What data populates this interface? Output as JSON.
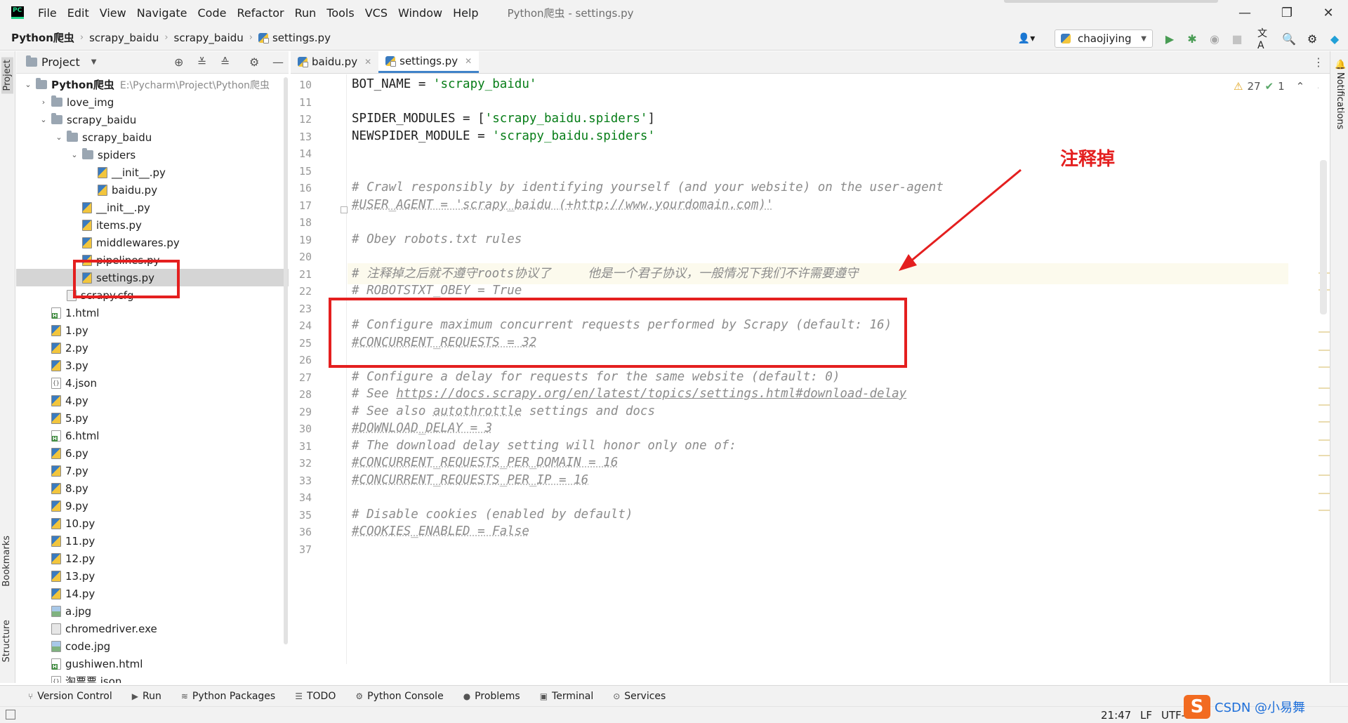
{
  "window": {
    "title": "Python爬虫 - settings.py",
    "menu": [
      "File",
      "Edit",
      "View",
      "Navigate",
      "Code",
      "Refactor",
      "Run",
      "Tools",
      "VCS",
      "Window",
      "Help"
    ],
    "controls": {
      "minimize": "—",
      "maximize": "❐",
      "close": "✕"
    }
  },
  "breadcrumb": [
    "Python爬虫",
    "scrapy_baidu",
    "scrapy_baidu",
    "settings.py"
  ],
  "toolbar": {
    "run_config": "chaojiying",
    "icons": [
      "user-icon",
      "run-icon",
      "debug-icon",
      "coverage-icon",
      "stop-icon",
      "translate-icon",
      "search-icon",
      "settings-icon",
      "jetbrains-icon"
    ]
  },
  "project_panel": {
    "title": "Project",
    "tree": [
      {
        "label": "Python爬虫",
        "path": "E:\\Pycharm\\Project\\Python爬虫",
        "type": "folder",
        "depth": 0,
        "expanded": true
      },
      {
        "label": "love_img",
        "type": "folder",
        "depth": 1,
        "expanded": false
      },
      {
        "label": "scrapy_baidu",
        "type": "folder",
        "depth": 1,
        "expanded": true
      },
      {
        "label": "scrapy_baidu",
        "type": "folder",
        "depth": 2,
        "expanded": true
      },
      {
        "label": "spiders",
        "type": "folder",
        "depth": 3,
        "expanded": true
      },
      {
        "label": "__init__.py",
        "type": "py",
        "depth": 4
      },
      {
        "label": "baidu.py",
        "type": "py",
        "depth": 4
      },
      {
        "label": "__init__.py",
        "type": "py",
        "depth": 3
      },
      {
        "label": "items.py",
        "type": "py",
        "depth": 3
      },
      {
        "label": "middlewares.py",
        "type": "py",
        "depth": 3
      },
      {
        "label": "pipelines.py",
        "type": "py",
        "depth": 3
      },
      {
        "label": "settings.py",
        "type": "py",
        "depth": 3,
        "selected": true
      },
      {
        "label": "scrapy.cfg",
        "type": "cfg",
        "depth": 2
      },
      {
        "label": "1.html",
        "type": "html",
        "depth": 1
      },
      {
        "label": "1.py",
        "type": "py",
        "depth": 1
      },
      {
        "label": "2.py",
        "type": "py",
        "depth": 1
      },
      {
        "label": "3.py",
        "type": "py",
        "depth": 1
      },
      {
        "label": "4.json",
        "type": "json",
        "depth": 1
      },
      {
        "label": "4.py",
        "type": "py",
        "depth": 1
      },
      {
        "label": "5.py",
        "type": "py",
        "depth": 1
      },
      {
        "label": "6.html",
        "type": "html",
        "depth": 1
      },
      {
        "label": "6.py",
        "type": "py",
        "depth": 1
      },
      {
        "label": "7.py",
        "type": "py",
        "depth": 1
      },
      {
        "label": "8.py",
        "type": "py",
        "depth": 1
      },
      {
        "label": "9.py",
        "type": "py",
        "depth": 1
      },
      {
        "label": "10.py",
        "type": "py",
        "depth": 1
      },
      {
        "label": "11.py",
        "type": "py",
        "depth": 1
      },
      {
        "label": "12.py",
        "type": "py",
        "depth": 1
      },
      {
        "label": "13.py",
        "type": "py",
        "depth": 1
      },
      {
        "label": "14.py",
        "type": "py",
        "depth": 1
      },
      {
        "label": "a.jpg",
        "type": "img",
        "depth": 1
      },
      {
        "label": "chromedriver.exe",
        "type": "exe",
        "depth": 1
      },
      {
        "label": "code.jpg",
        "type": "img",
        "depth": 1
      },
      {
        "label": "gushiwen.html",
        "type": "html",
        "depth": 1
      },
      {
        "label": "淘票票.json",
        "type": "json",
        "depth": 1
      }
    ]
  },
  "side_tabs": {
    "left": [
      "Project",
      "Bookmarks",
      "Structure"
    ],
    "right": [
      "Notifications"
    ]
  },
  "editor": {
    "tabs": [
      {
        "label": "baidu.py",
        "active": false
      },
      {
        "label": "settings.py",
        "active": true
      }
    ],
    "inspection": {
      "warnings": "27",
      "ok": "1"
    },
    "lines": [
      {
        "n": "10",
        "parts": [
          [
            "plain",
            "BOT_NAME = "
          ],
          [
            "str",
            "'scrapy_baidu'"
          ]
        ]
      },
      {
        "n": "11",
        "parts": []
      },
      {
        "n": "12",
        "parts": [
          [
            "plain",
            "SPIDER_MODULES = ["
          ],
          [
            "str",
            "'scrapy_baidu.spiders'"
          ],
          [
            "plain",
            "]"
          ]
        ]
      },
      {
        "n": "13",
        "parts": [
          [
            "plain",
            "NEWSPIDER_MODULE = "
          ],
          [
            "str",
            "'scrapy_baidu.spiders'"
          ]
        ]
      },
      {
        "n": "14",
        "parts": []
      },
      {
        "n": "15",
        "parts": []
      },
      {
        "n": "16",
        "parts": [
          [
            "cm",
            "# Crawl responsibly by identifying yourself (and your website) on the user-agent"
          ]
        ]
      },
      {
        "n": "17",
        "parts": [
          [
            "cm wavy",
            "#USER_AGENT = 'scrapy_baidu (+http://www.yourdomain.com)'"
          ]
        ]
      },
      {
        "n": "18",
        "parts": []
      },
      {
        "n": "19",
        "parts": [
          [
            "cm",
            "# Obey robots.txt rules"
          ]
        ]
      },
      {
        "n": "20",
        "parts": []
      },
      {
        "n": "21",
        "parts": [
          [
            "cm",
            "# 注释掉之后就不遵守roots协议了     他是一个君子协议，一般情况下我们不许需要遵守"
          ]
        ],
        "current": true
      },
      {
        "n": "22",
        "parts": [
          [
            "cm",
            "# ROBOTSTXT_OBEY = True"
          ]
        ]
      },
      {
        "n": "23",
        "parts": []
      },
      {
        "n": "24",
        "parts": [
          [
            "cm",
            "# Configure maximum concurrent requests performed by Scrapy (default: 16)"
          ]
        ]
      },
      {
        "n": "25",
        "parts": [
          [
            "cm wavy",
            "#CONCURRENT_REQUESTS = 32"
          ]
        ]
      },
      {
        "n": "26",
        "parts": []
      },
      {
        "n": "27",
        "parts": [
          [
            "cm",
            "# Configure a delay for requests for the same website (default: 0)"
          ]
        ]
      },
      {
        "n": "28",
        "parts": [
          [
            "cm",
            "# See "
          ],
          [
            "lnk",
            "https://docs.scrapy.org/en/latest/topics/settings.html#download-delay"
          ]
        ]
      },
      {
        "n": "29",
        "parts": [
          [
            "cm",
            "# See also "
          ],
          [
            "cm wavy",
            "autothrottle"
          ],
          [
            "cm",
            " settings and docs"
          ]
        ]
      },
      {
        "n": "30",
        "parts": [
          [
            "cm wavy",
            "#DOWNLOAD_DELAY = 3"
          ]
        ]
      },
      {
        "n": "31",
        "parts": [
          [
            "cm",
            "# The download delay setting will honor only one of:"
          ]
        ]
      },
      {
        "n": "32",
        "parts": [
          [
            "cm wavy",
            "#CONCURRENT_REQUESTS_PER_DOMAIN = 16"
          ]
        ]
      },
      {
        "n": "33",
        "parts": [
          [
            "cm wavy",
            "#CONCURRENT_REQUESTS_PER_IP = 16"
          ]
        ]
      },
      {
        "n": "34",
        "parts": []
      },
      {
        "n": "35",
        "parts": [
          [
            "cm",
            "# Disable cookies (enabled by default)"
          ]
        ]
      },
      {
        "n": "36",
        "parts": [
          [
            "cm wavy",
            "#COOKIES_ENABLED = False"
          ]
        ]
      },
      {
        "n": "37",
        "parts": []
      }
    ]
  },
  "annotation": {
    "label": "注释掉",
    "color": "#e41f1f"
  },
  "bottom_tools": [
    "Version Control",
    "Run",
    "Python Packages",
    "TODO",
    "Python Console",
    "Problems",
    "Terminal",
    "Services"
  ],
  "status": {
    "position": "21:47",
    "line_sep": "LF",
    "encoding": "UTF-"
  },
  "watermark": "CSDN @小易舞",
  "colors": {
    "accent": "#4083c9",
    "string": "#067d17",
    "comment": "#8c8c8c",
    "annotation": "#e41f1f"
  }
}
